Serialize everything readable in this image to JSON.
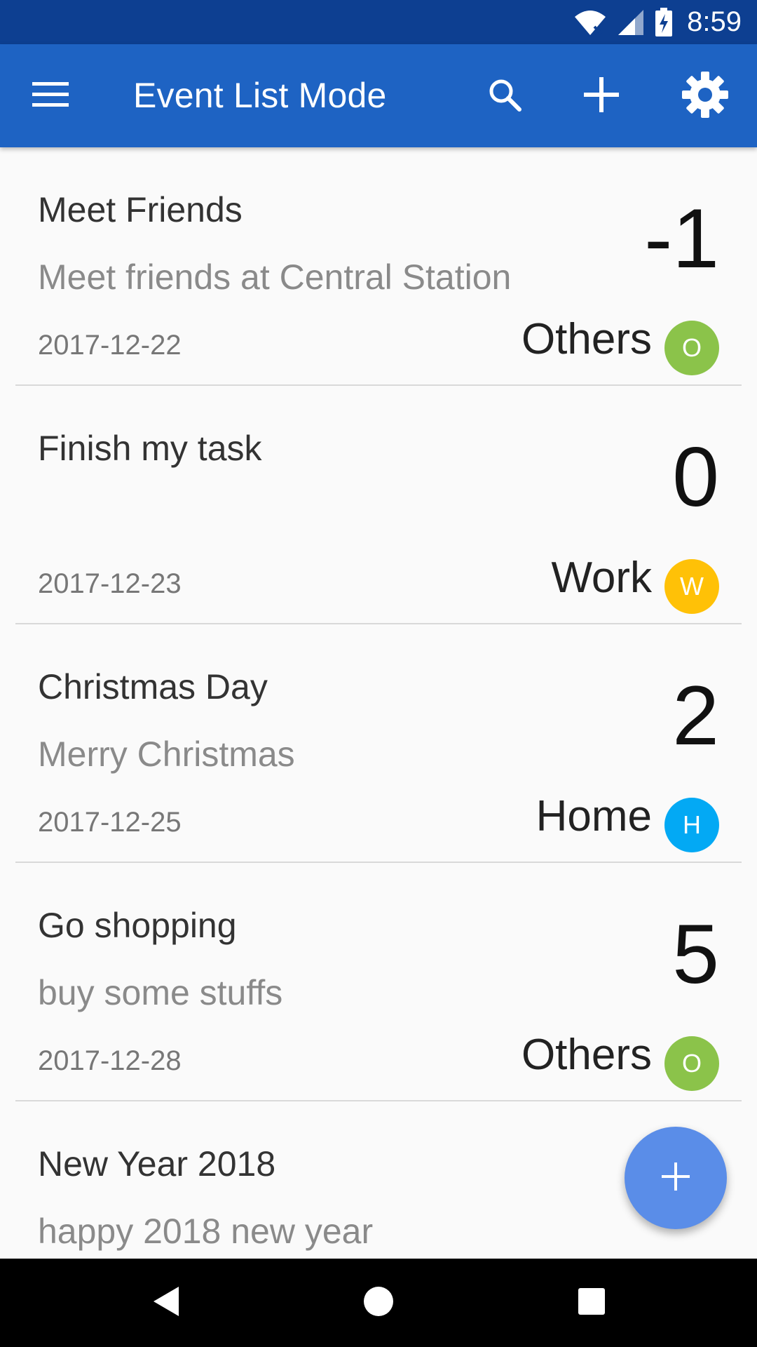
{
  "status_bar": {
    "time": "8:59",
    "icons": [
      "wifi-icon",
      "signal-icon",
      "battery-charging-icon"
    ]
  },
  "app_bar": {
    "title": "Event List Mode",
    "icons": {
      "menu": "menu-icon",
      "search": "search-icon",
      "add": "plus-icon",
      "settings": "gear-icon"
    },
    "background": "#1e63c3"
  },
  "events": [
    {
      "title": "Meet Friends",
      "description": "Meet friends at Central Station",
      "date": "2017-12-22",
      "days": "-1",
      "category": "Others",
      "badge": "O",
      "badge_color": "#8bc34a"
    },
    {
      "title": "Finish my task",
      "description": "",
      "date": "2017-12-23",
      "days": "0",
      "category": "Work",
      "badge": "W",
      "badge_color": "#ffc107"
    },
    {
      "title": "Christmas Day",
      "description": "Merry Christmas",
      "date": "2017-12-25",
      "days": "2",
      "category": "Home",
      "badge": "H",
      "badge_color": "#03a9f4"
    },
    {
      "title": "Go shopping",
      "description": "buy some stuffs",
      "date": "2017-12-28",
      "days": "5",
      "category": "Others",
      "badge": "O",
      "badge_color": "#8bc34a"
    },
    {
      "title": "New Year 2018",
      "description": "happy 2018 new year",
      "date": "",
      "days": "",
      "category": "",
      "badge": "",
      "badge_color": "#8bc34a"
    }
  ],
  "fab": {
    "icon": "plus-icon",
    "color": "#5a8de8"
  },
  "nav_bar": {
    "icons": [
      "back-icon",
      "home-icon",
      "recents-icon"
    ]
  }
}
